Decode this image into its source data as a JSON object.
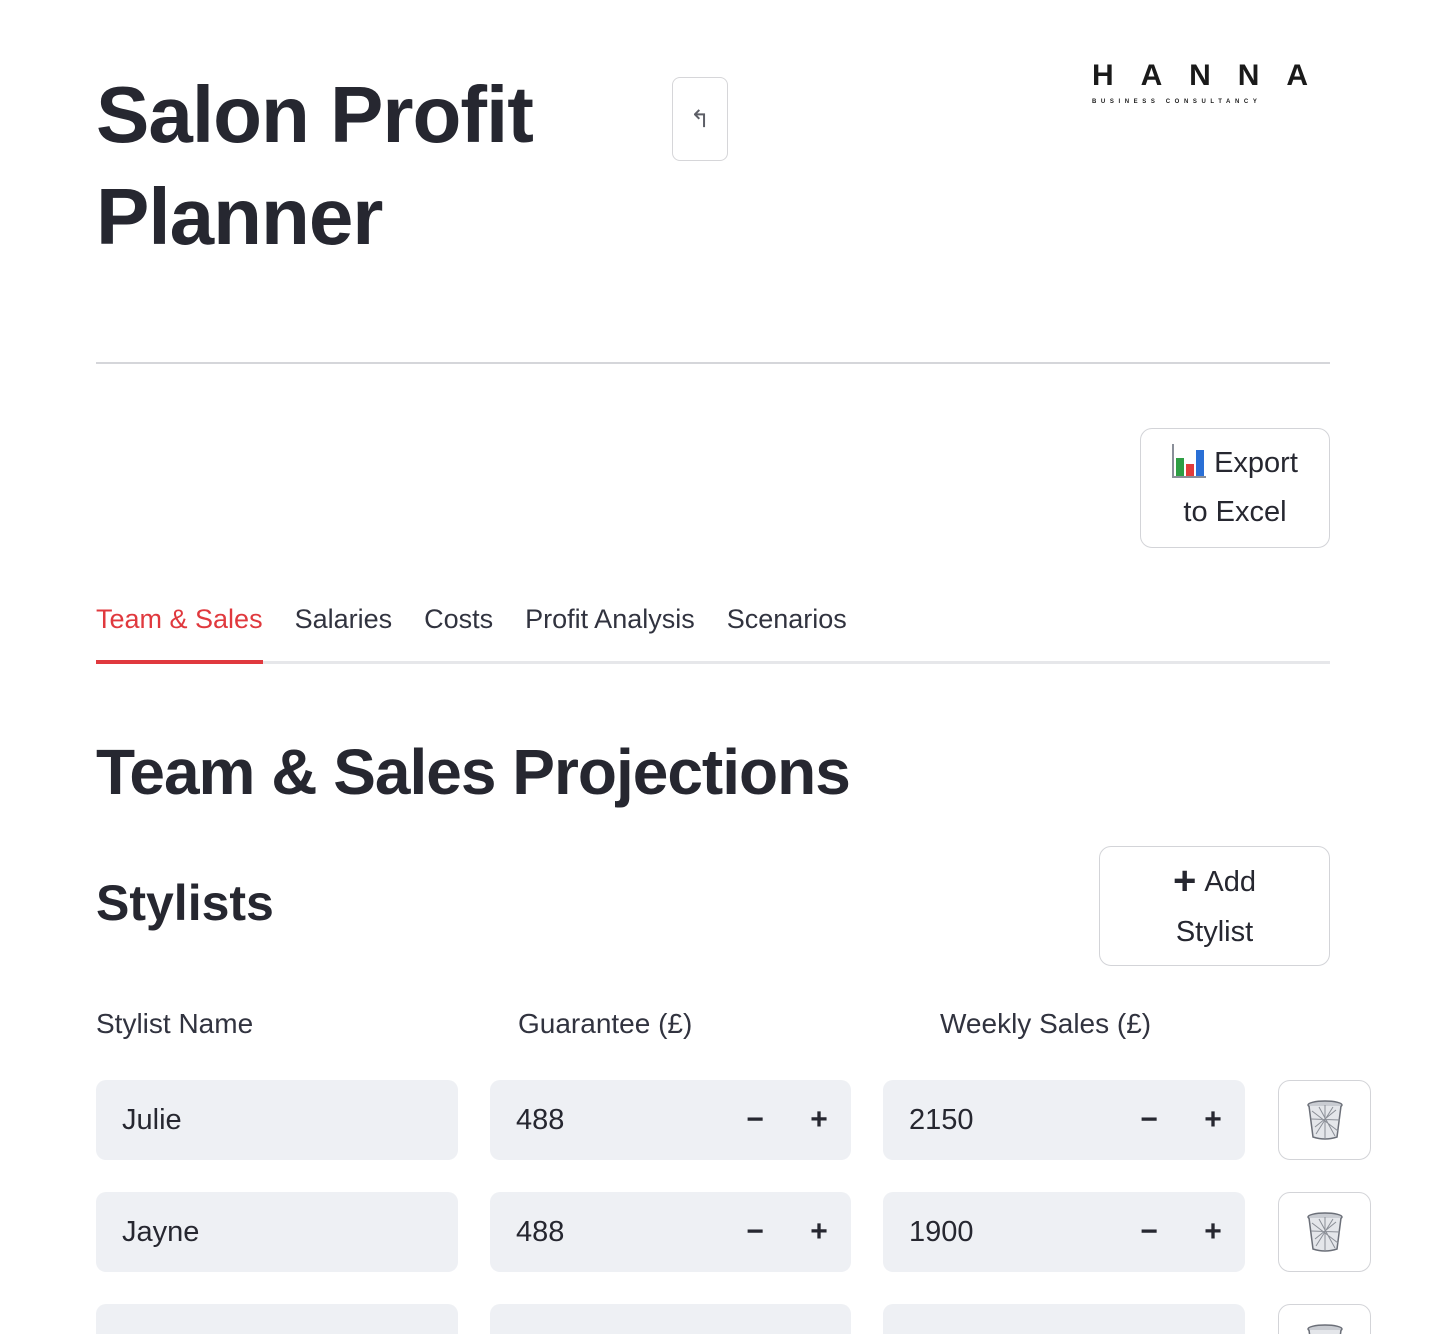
{
  "header": {
    "title": "Salon Profit Planner",
    "anchor_icon": "↰"
  },
  "logo": {
    "letters": [
      "H",
      "A",
      "N",
      "N",
      "A"
    ],
    "tagline": "BUSINESS CONSULTANCY"
  },
  "export_button": {
    "label": "Export to Excel",
    "icon": "bar-chart-icon",
    "icon_colors": [
      "#2e9e44",
      "#e23b3b",
      "#2a6fd6"
    ]
  },
  "tabs": [
    {
      "label": "Team & Sales",
      "active": true
    },
    {
      "label": "Salaries",
      "active": false
    },
    {
      "label": "Costs",
      "active": false
    },
    {
      "label": "Profit Analysis",
      "active": false
    },
    {
      "label": "Scenarios",
      "active": false
    }
  ],
  "section": {
    "title": "Team & Sales Projections",
    "subtitle": "Stylists"
  },
  "add_button": {
    "icon": "+",
    "label": "Add Stylist"
  },
  "columns": {
    "name": "Stylist Name",
    "guarantee": "Guarantee (£)",
    "weekly_sales": "Weekly Sales (£)"
  },
  "stepper": {
    "minus": "−",
    "plus": "+"
  },
  "stylists": [
    {
      "name": "Julie",
      "guarantee": "488",
      "weekly_sales": "2150"
    },
    {
      "name": "Jayne",
      "guarantee": "488",
      "weekly_sales": "1900"
    }
  ],
  "accent_color": "#e0393e"
}
